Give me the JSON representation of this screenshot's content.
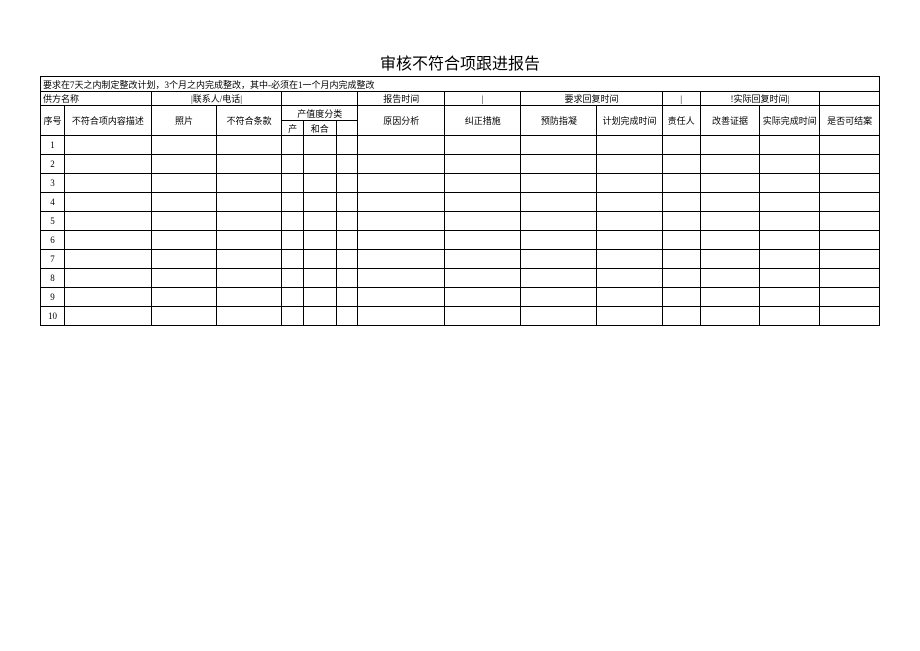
{
  "title": "审核不符合项跟进报告",
  "note": "要求在7天之内制定整改计划，3个月之内完成整改，其中-必须在1一个月内完成整改",
  "info": {
    "supplier_label": "供方名称",
    "contact_label": "|联系人/电话|",
    "report_time_label": "报告时间",
    "sep1": "|",
    "require_reply_label": "要求回复时间",
    "sep2": "|",
    "actual_reply_label": "!实际回复时间|"
  },
  "headers": {
    "seq": "序号",
    "desc": "不符合项内容描述",
    "photo": "照片",
    "clause": "不符合条款",
    "severity_group": "产值度分类",
    "sev_a": "产",
    "sev_b": "和合",
    "cause": "原因分析",
    "corrective": "纠正措施",
    "preventive": "预防指凝",
    "plan_time": "计划完成时间",
    "owner": "责任人",
    "evidence": "改善证据",
    "actual_time": "实际完成时间",
    "closed": "是否可结案"
  },
  "rows": [
    {
      "seq": "1"
    },
    {
      "seq": "2"
    },
    {
      "seq": "3"
    },
    {
      "seq": "4"
    },
    {
      "seq": "5"
    },
    {
      "seq": "6"
    },
    {
      "seq": "7"
    },
    {
      "seq": "8"
    },
    {
      "seq": "9"
    },
    {
      "seq": "10"
    }
  ]
}
